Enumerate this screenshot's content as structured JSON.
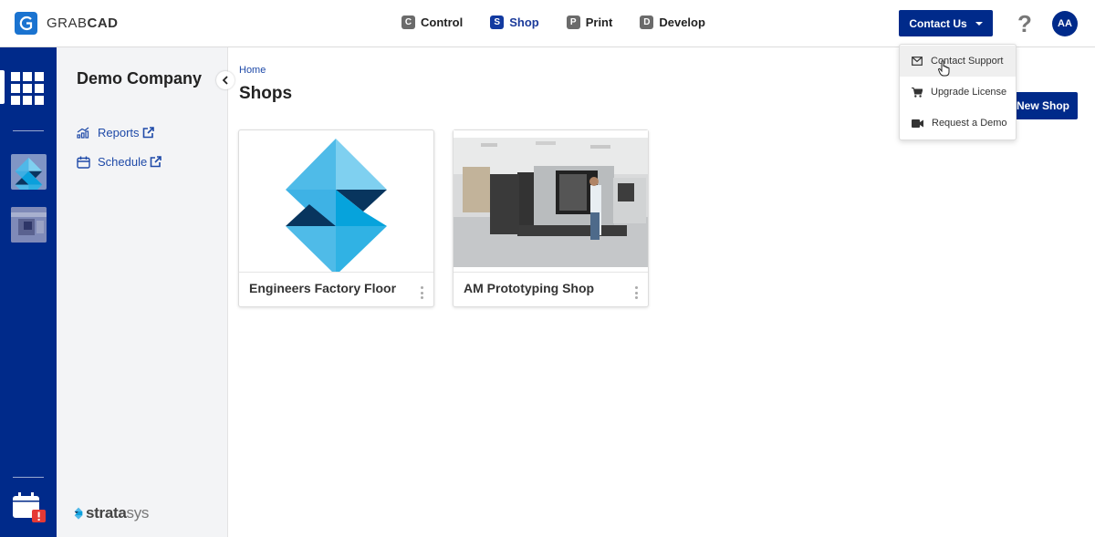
{
  "brand": {
    "name_light": "GRAB",
    "name_bold": "CAD"
  },
  "apps": [
    {
      "badge": "C",
      "label": "Control",
      "active": false
    },
    {
      "badge": "S",
      "label": "Shop",
      "active": true
    },
    {
      "badge": "P",
      "label": "Print",
      "active": false
    },
    {
      "badge": "D",
      "label": "Develop",
      "active": false
    }
  ],
  "header": {
    "contact_label": "Contact Us",
    "help_label": "?",
    "avatar_initials": "AA"
  },
  "contact_menu": {
    "items": [
      {
        "icon": "envelope-icon",
        "label": "Contact Support",
        "hovered": true
      },
      {
        "icon": "cart-icon",
        "label": "Upgrade License",
        "hovered": false
      },
      {
        "icon": "video-camera-icon",
        "label": "Request a Demo",
        "hovered": false
      }
    ]
  },
  "sidebar": {
    "title": "Demo Company",
    "links": [
      {
        "icon": "reports-chart-icon",
        "label": "Reports",
        "external": true
      },
      {
        "icon": "calendar-icon",
        "label": "Schedule",
        "external": true
      }
    ],
    "footer_logo": {
      "bold": "strata",
      "light": "sys"
    }
  },
  "main": {
    "breadcrumb": "Home",
    "title": "Shops",
    "new_shop_label": "New Shop",
    "shops": [
      {
        "name": "Engineers Factory Floor",
        "image": "stratasys-logo"
      },
      {
        "name": "AM Prototyping Shop",
        "image": "printer-photo"
      }
    ]
  },
  "colors": {
    "primary": "#002a8a",
    "link": "#1f4aa8",
    "sidebar_bg": "#f3f4f6",
    "alert": "#e53935"
  }
}
